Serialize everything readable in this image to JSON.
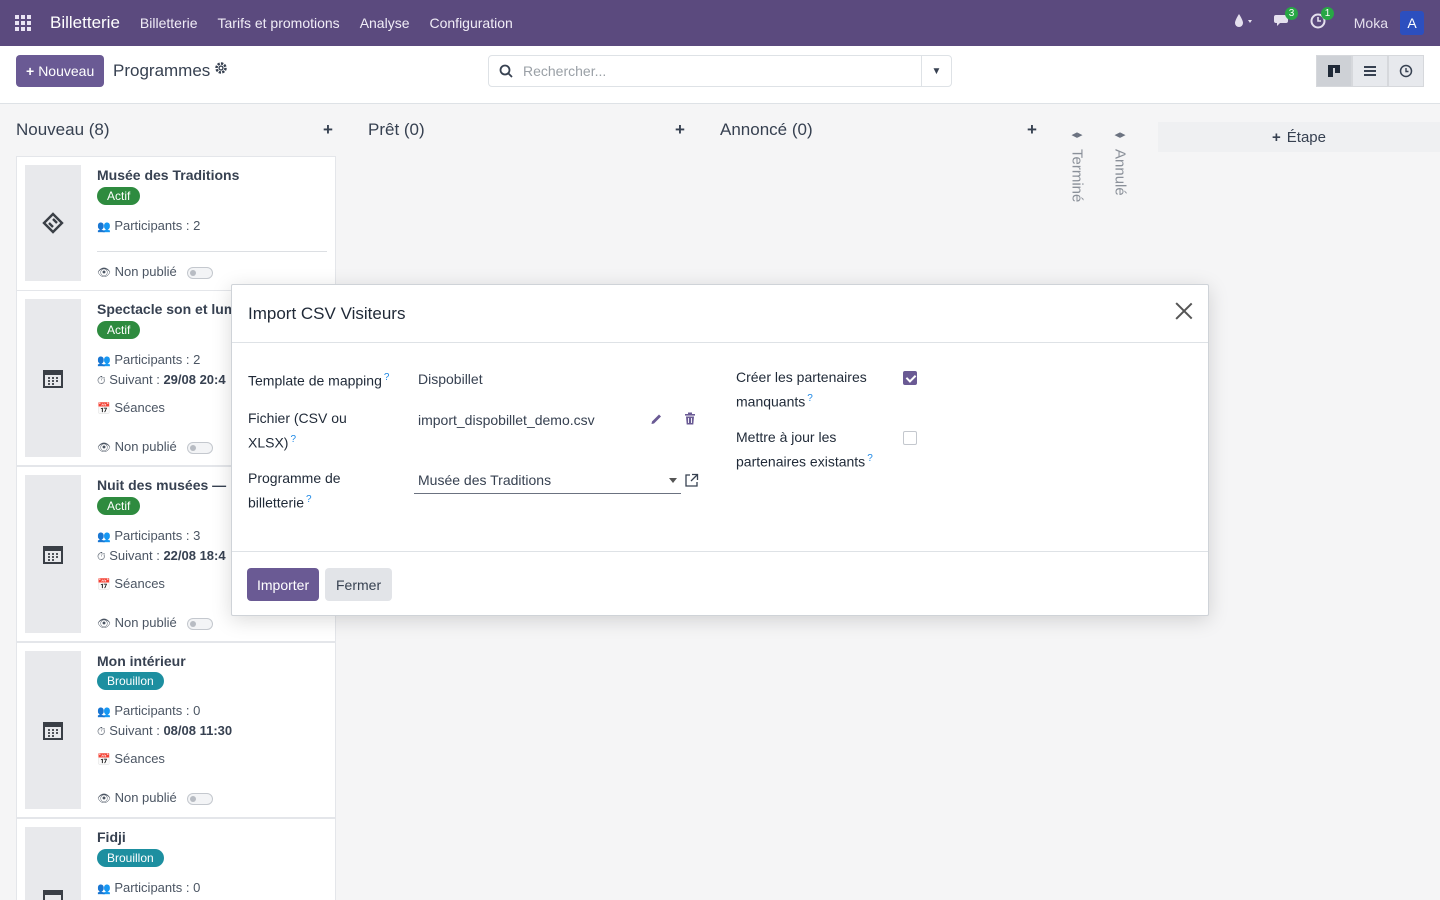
{
  "navbar": {
    "brand": "Billetterie",
    "menu": [
      "Billetterie",
      "Tarifs et promotions",
      "Analyse",
      "Configuration"
    ],
    "chat_count": "3",
    "activity_count": "1",
    "user": "Moka",
    "avatar_letter": "A"
  },
  "control": {
    "new_label": "Nouveau",
    "title": "Programmes",
    "search_placeholder": "Rechercher..."
  },
  "kanban": {
    "columns": [
      {
        "label": "Nouveau (8)"
      },
      {
        "label": "Prêt (0)"
      },
      {
        "label": "Annoncé (0)"
      }
    ],
    "folded": [
      "Terminé",
      "Annulé"
    ],
    "add_stage": "Étape",
    "cards": [
      {
        "title": "Musée des Traditions",
        "status": "Actif",
        "participants": "Participants : 2",
        "unpublished": "Non publié"
      },
      {
        "title": "Spectacle son et lum",
        "status": "Actif",
        "participants": "Participants : 2",
        "next_label": "Suivant :",
        "next_value": "29/08 20:4",
        "sessions": "Séances",
        "unpublished": "Non publié"
      },
      {
        "title": "Nuit des musées — ",
        "status": "Actif",
        "participants": "Participants : 3",
        "next_label": "Suivant :",
        "next_value": "22/08 18:4",
        "sessions": "Séances",
        "unpublished": "Non publié"
      },
      {
        "title": "Mon intérieur",
        "status": "Brouillon",
        "participants": "Participants : 0",
        "next_label": "Suivant :",
        "next_value": "08/08 11:30",
        "sessions": "Séances",
        "unpublished": "Non publié"
      },
      {
        "title": "Fidji",
        "status": "Brouillon",
        "participants": "Participants : 0"
      }
    ]
  },
  "modal": {
    "title": "Import CSV Visiteurs",
    "fields": {
      "template_label": "Template de mapping",
      "template_value": "Dispobillet",
      "file_label": "Fichier (CSV ou XLSX)",
      "file_value": "import_dispobillet_demo.csv",
      "program_label": "Programme de billetterie",
      "program_value": "Musée des Traditions",
      "create_label": "Créer les partenaires manquants",
      "create_checked": true,
      "update_label": "Mettre à jour les partenaires existants",
      "update_checked": false
    },
    "import_label": "Importer",
    "close_label": "Fermer"
  },
  "colors": {
    "navbar": "#5b4a7e",
    "primary": "#6a5a94",
    "badge_active": "#2e8b3f",
    "badge_draft": "#1d8fa0"
  }
}
